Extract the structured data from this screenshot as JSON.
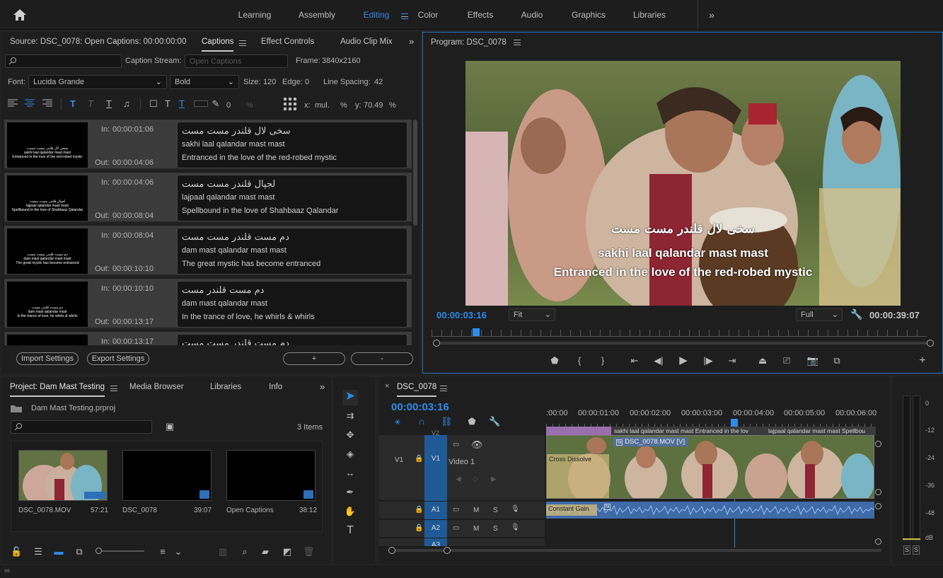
{
  "workspace": {
    "tabs": [
      "Learning",
      "Assembly",
      "Editing",
      "Color",
      "Effects",
      "Audio",
      "Graphics",
      "Libraries"
    ],
    "active": "Editing"
  },
  "source_panel": {
    "title": "Source: DSC_0078: Open Captions: 00:00:00:00",
    "tabs": [
      "Captions",
      "Effect Controls",
      "Audio Clip Mix"
    ],
    "caption_stream_label": "Caption Stream:",
    "caption_stream_value": "Open Captions",
    "frame_label": "Frame:",
    "frame_value": "3840x2160",
    "font_label": "Font:",
    "font_value": "Lucida Grande",
    "style_value": "Bold",
    "size_label": "Size:",
    "size_value": "120",
    "edge_label": "Edge:",
    "edge_value": "0",
    "line_spacing_label": "Line Spacing:",
    "line_spacing_value": "42",
    "opacity_value": "0",
    "opacity_unit": "%",
    "x_label": "x:",
    "x_value": "mul.",
    "x_unit": "%",
    "y_label": "y:",
    "y_value": "70.49",
    "y_unit": "%",
    "in_label": "In:",
    "out_label": "Out:",
    "captions": [
      {
        "in": "00:00:01:06",
        "out": "00:00:04:06",
        "urdu": "سخی لال قلندر مست مست",
        "roman": "sakhi laal qalandar mast mast",
        "english": "Entranced in the love of the red-robed mystic",
        "thumb_roman": "sakhi laal qalandar mast mast",
        "thumb_english": "Entranced in the love of the red-robed mystic"
      },
      {
        "in": "00:00:04:06",
        "out": "00:00:08:04",
        "urdu": "لجپال قلندر مست مست",
        "roman": "lajpaal qalandar mast mast",
        "english": "Spellbound in the love of Shahbaaz Qalandar",
        "thumb_roman": "lajpaal qalandar mast mast",
        "thumb_english": "Spellbound in the love of Shahbaaz Qalandar"
      },
      {
        "in": "00:00:08:04",
        "out": "00:00:10:10",
        "urdu": "دم مست قلندر مست مست",
        "roman": "dam mast qalandar mast mast",
        "english": "The great mystic has become entranced",
        "thumb_roman": "dam mast qalandar mast mast",
        "thumb_english": "The great mystic has become entranced"
      },
      {
        "in": "00:00:10:10",
        "out": "00:00:13:17",
        "urdu": "دم مست قلندر مست",
        "roman": "dam mast qalandar mast",
        "english": "In the trance of love, he whirls & whirls",
        "thumb_roman": "dam mast qalandar mast",
        "thumb_english": "In the trance of love, he whirls & whirls"
      },
      {
        "in": "00:00:13:17",
        "urdu": "دم مست قلندر مست مست"
      }
    ],
    "import_settings": "Import Settings",
    "export_settings": "Export Settings",
    "add_label": "+",
    "remove_label": "-"
  },
  "program_panel": {
    "title": "Program: DSC_0078",
    "overlay_urdu": "سخی لال قلندر مست مست",
    "overlay_roman": "sakhi laal qalandar mast mast",
    "overlay_english": "Entranced in the love of the red-robed mystic",
    "timecode": "00:00:03:16",
    "fit": "Fit",
    "quality": "Full",
    "duration": "00:00:39:07",
    "playhead_fraction": 0.09
  },
  "project_panel": {
    "tabs": [
      "Project: Dam Mast Testing",
      "Media Browser",
      "Libraries",
      "Info"
    ],
    "file": "Dam Mast Testing.prproj",
    "items_count": "3 Items",
    "items": [
      {
        "name": "DSC_0078.MOV",
        "duration": "57:21"
      },
      {
        "name": "DSC_0078",
        "duration": "39:07"
      },
      {
        "name": "Open Captions",
        "duration": "38:12"
      }
    ]
  },
  "timeline": {
    "title": "DSC_0078",
    "timecode": "00:00:03:16",
    "ruler": [
      ":00:00",
      "00:00:01:00",
      "00:00:02:00",
      "00:00:03:00",
      "00:00:04:00",
      "00:00:05:00",
      "00:00:06:00"
    ],
    "caption_track_text": "sakhi laal qalandar mast mast Entranced in the lov",
    "caption_track_text2": "lajpaal qalandar mast mast Spellbou",
    "tracks": [
      {
        "id": "V2",
        "label": ""
      },
      {
        "id": "V1",
        "label": "Video 1"
      },
      {
        "id": "A1",
        "label": ""
      },
      {
        "id": "A2",
        "label": ""
      },
      {
        "id": "A3",
        "label": ""
      }
    ],
    "video_clip": "DSC_0078.MOV [V]",
    "transition": "Cross Dissolve",
    "audio_transition": "Constant Gain",
    "track_letters": {
      "m": "M",
      "s": "S"
    }
  },
  "meter": {
    "labels": [
      "0",
      "-12",
      "-24",
      "-36",
      "-48",
      "dB"
    ],
    "solo": [
      "S",
      "S"
    ]
  }
}
